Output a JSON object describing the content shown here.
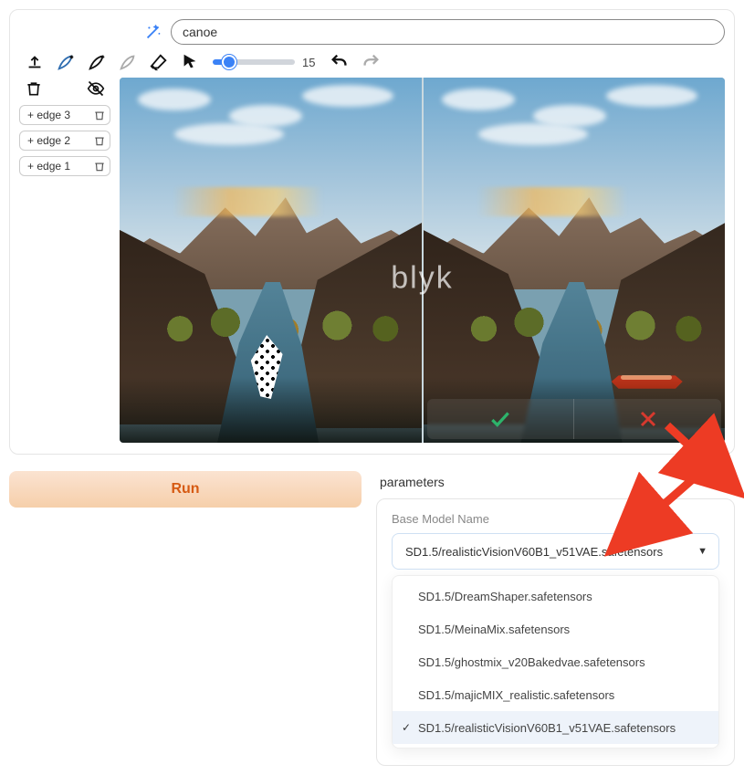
{
  "prompt": {
    "value": "canoe",
    "placeholder": ""
  },
  "toolbar": {
    "brush_size": 15,
    "icons": {
      "upload": "upload-icon",
      "feather_add": "feather-plus-icon",
      "feather_sub": "feather-minus-icon",
      "feather_rgb": "feather-rgb-icon",
      "eraser": "eraser-icon",
      "pointer": "pointer-icon",
      "undo": "undo-icon",
      "redo": "redo-icon"
    }
  },
  "layers": {
    "tools": {
      "trash": "trash-icon",
      "visibility": "visibility-off-icon"
    },
    "items": [
      {
        "label": "+ edge 3"
      },
      {
        "label": "+ edge 2"
      },
      {
        "label": "+ edge 1"
      }
    ]
  },
  "canvas": {
    "watermark": "blyk",
    "result_subject": "canoe",
    "mask_present": true
  },
  "actions": {
    "run_label": "Run",
    "accept": "accept-icon",
    "reject": "reject-icon"
  },
  "parameters": {
    "title": "parameters",
    "expanded": true,
    "fields": {
      "base_model": {
        "label": "Base Model Name",
        "value": "SD1.5/realisticVisionV60B1_v51VAE.safetensors",
        "options": [
          "SD1.5/DreamShaper.safetensors",
          "SD1.5/MeinaMix.safetensors",
          "SD1.5/ghostmix_v20Bakedvae.safetensors",
          "SD1.5/majicMIX_realistic.safetensors",
          "SD1.5/realisticVisionV60B1_v51VAE.safetensors"
        ],
        "selected_index": 4
      }
    }
  },
  "annotations": {
    "arrow_color": "#ED3B24"
  }
}
